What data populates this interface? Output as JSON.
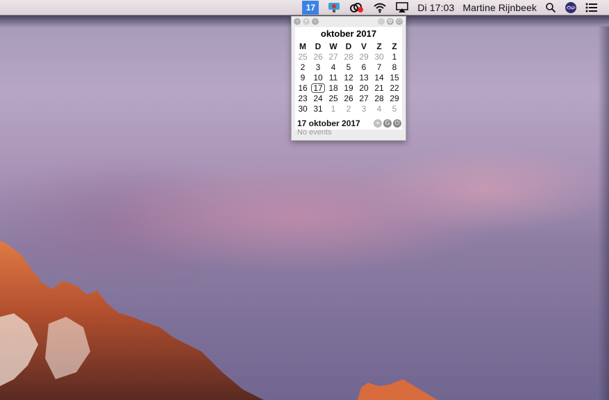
{
  "menubar": {
    "calendar_badge": "17",
    "clock": "Di 17:03",
    "user_name": "Martine Rijnbeek",
    "icons": [
      "calendar-badge-icon",
      "screen-recorder-icon",
      "creative-cloud-icon",
      "wifi-icon",
      "airplay-icon",
      "search-icon",
      "siri-icon",
      "notification-center-icon"
    ]
  },
  "calendar": {
    "month_title": "oktober 2017",
    "weekday_headers": [
      "M",
      "D",
      "W",
      "D",
      "V",
      "Z",
      "Z"
    ],
    "weeks": [
      [
        "25",
        "26",
        "27",
        "28",
        "29",
        "30",
        "1"
      ],
      [
        "2",
        "3",
        "4",
        "5",
        "6",
        "7",
        "8"
      ],
      [
        "9",
        "10",
        "11",
        "12",
        "13",
        "14",
        "15"
      ],
      [
        "16",
        "17",
        "18",
        "19",
        "20",
        "21",
        "22"
      ],
      [
        "23",
        "24",
        "25",
        "26",
        "27",
        "28",
        "29"
      ],
      [
        "30",
        "31",
        "1",
        "2",
        "3",
        "4",
        "5"
      ]
    ],
    "today": "17",
    "selected_date": "17 oktober 2017",
    "no_events": "No events"
  },
  "colors": {
    "accent": "#3b82e6",
    "out_of_month_text": "#9a9a9a"
  }
}
